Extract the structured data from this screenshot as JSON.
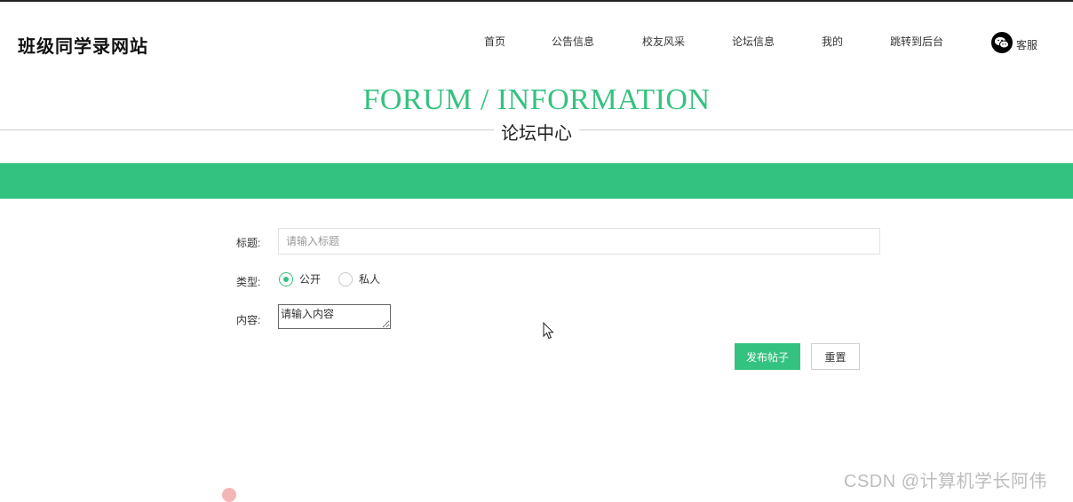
{
  "header": {
    "logo": "班级同学录网站",
    "nav": [
      {
        "label": "首页"
      },
      {
        "label": "公告信息"
      },
      {
        "label": "校友风采"
      },
      {
        "label": "论坛信息"
      },
      {
        "label": "我的"
      },
      {
        "label": "跳转到后台"
      }
    ],
    "service_label": "客服",
    "service_icon": "wechat-icon"
  },
  "hero": {
    "title_en": "FORUM / INFORMATION",
    "title_cn": "论坛中心"
  },
  "form": {
    "title_label": "标题:",
    "title_value": "",
    "title_placeholder": "请输入标题",
    "type_label": "类型:",
    "type_options": [
      {
        "label": "公开",
        "selected": true
      },
      {
        "label": "私人",
        "selected": false
      }
    ],
    "content_label": "内容:",
    "content_value": "",
    "content_placeholder": "请输入内容",
    "submit_label": "发布帖子",
    "reset_label": "重置"
  },
  "watermark": "CSDN @计算机学长阿伟",
  "colors": {
    "accent": "#33c27f",
    "hero_text": "#34c27f"
  }
}
